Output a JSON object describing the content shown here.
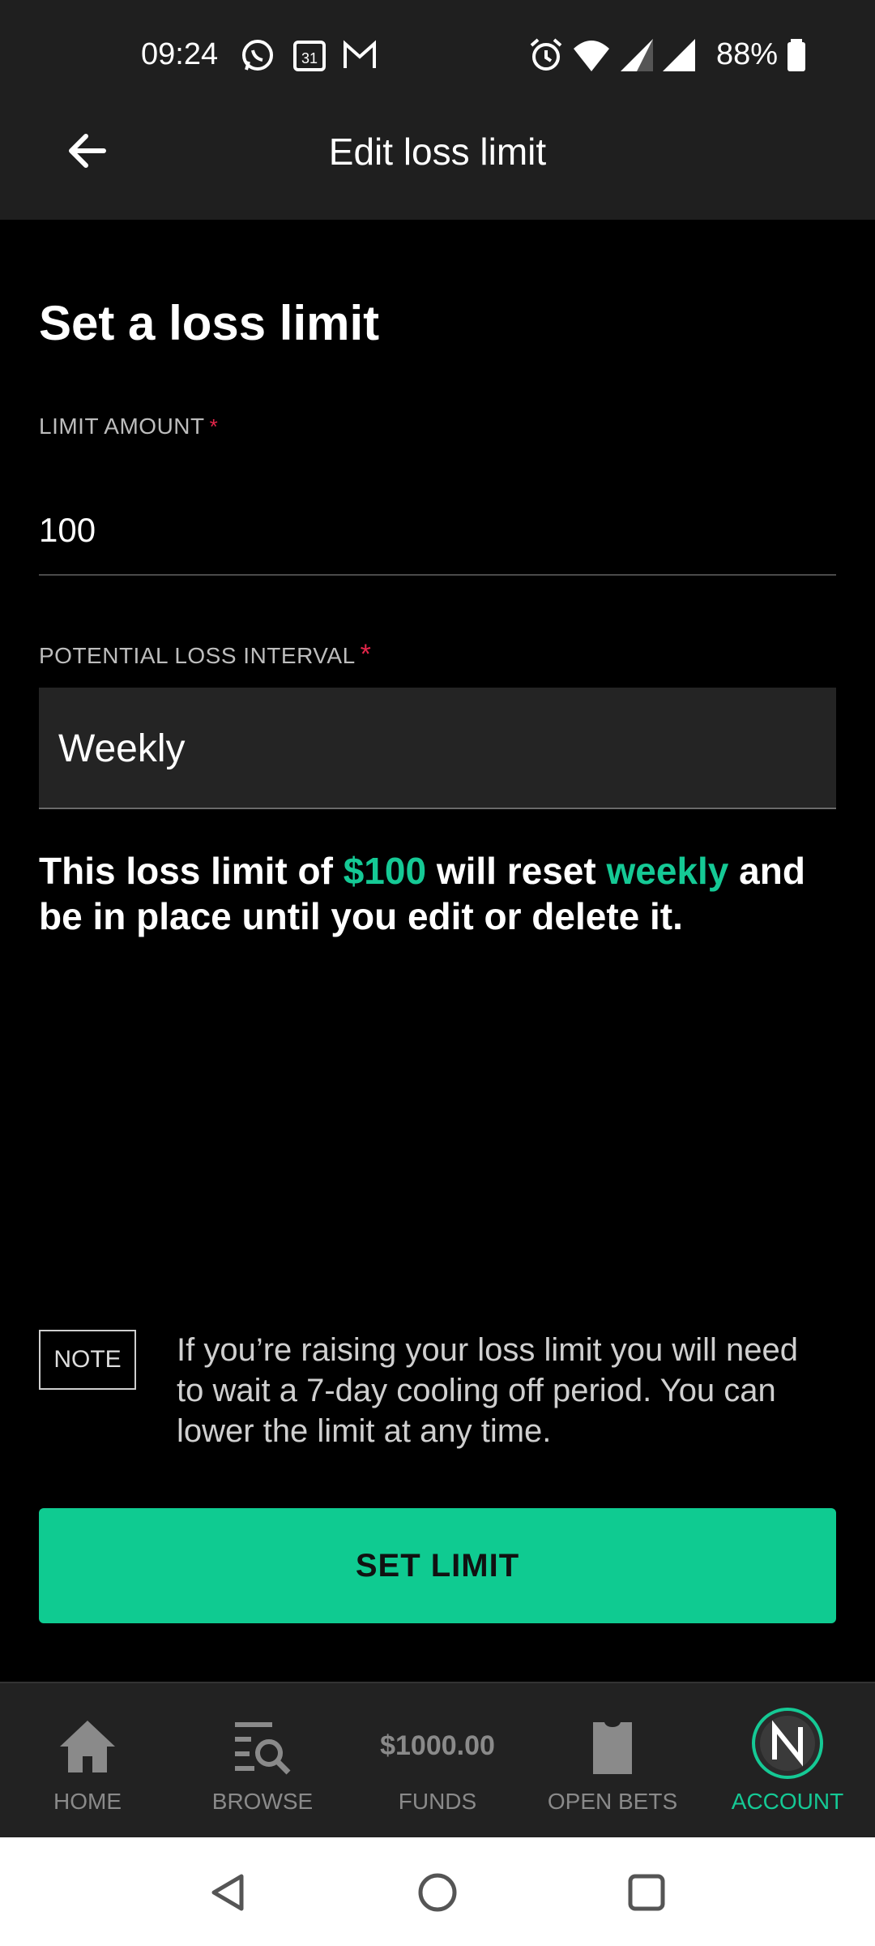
{
  "status_bar": {
    "time": "09:24",
    "battery": "88%",
    "icons": [
      "whatsapp-icon",
      "calendar-icon",
      "gmail-icon",
      "alarm-icon",
      "wifi-icon",
      "signal-r-icon",
      "signal-icon",
      "battery-icon"
    ],
    "calendar_day": "31"
  },
  "app_bar": {
    "title": "Edit loss limit"
  },
  "form": {
    "heading": "Set a loss limit",
    "amount_label": "LIMIT AMOUNT",
    "amount_value": "100",
    "interval_label": "POTENTIAL LOSS INTERVAL",
    "interval_value": "Weekly",
    "required_mark": "*"
  },
  "summary": {
    "part1": "This loss limit of ",
    "amount": "$100",
    "part2": " will reset ",
    "interval": "weekly",
    "part3": " and be in place until you edit or delete it."
  },
  "note": {
    "badge": "NOTE",
    "text": "If you’re raising your loss limit you will need to wait a 7-day cooling off period. You can lower the limit at any time."
  },
  "action": {
    "set_limit_label": "SET LIMIT"
  },
  "bottom_nav": {
    "home": "HOME",
    "browse": "BROWSE",
    "funds_amount": "$1000.00",
    "funds": "FUNDS",
    "open_bets": "OPEN BETS",
    "account": "ACCOUNT"
  },
  "colors": {
    "accent": "#0fcb91",
    "required": "#e3264a",
    "bar": "#1f1f1f"
  }
}
